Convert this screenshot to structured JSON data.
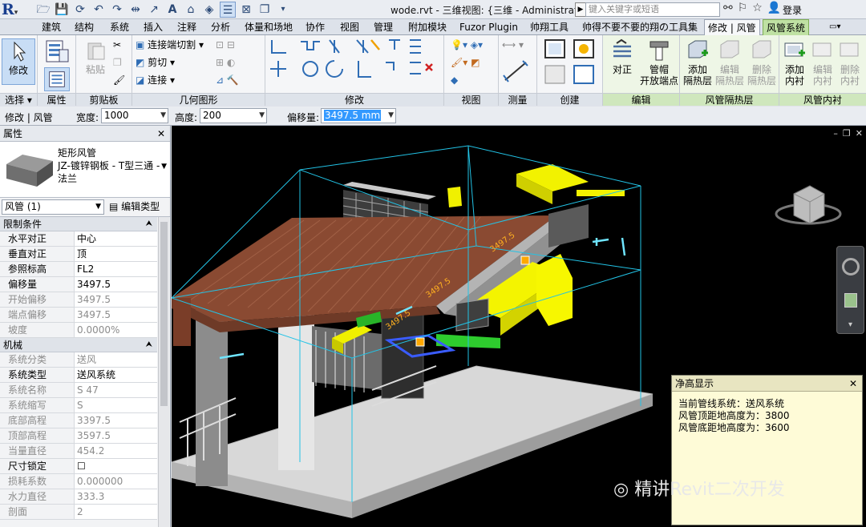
{
  "titlebar": {
    "logo": "R",
    "doc_title": "wode.rvt - 三维视图: {三维 - Administrat...",
    "search_placeholder": "键入关键字或短语",
    "login": "登录"
  },
  "tabs": [
    "建筑",
    "结构",
    "系统",
    "插入",
    "注释",
    "分析",
    "体量和场地",
    "协作",
    "视图",
    "管理",
    "附加模块",
    "Fuzor Plugin",
    "帅翔工具",
    "帅得不要不要的翔の工具集",
    "修改 | 风管",
    "风管系统"
  ],
  "ribbon": {
    "panels": {
      "select": "选择",
      "properties": "属性",
      "clipboard": "剪贴板",
      "geometry": "几何图形",
      "modify": "修改",
      "view": "视图",
      "measure": "测量",
      "create": "创建",
      "edit": "编辑",
      "insulation": "风管隔热层",
      "lining": "风管内衬"
    },
    "modify_btn": "修改",
    "paste_btn": "粘贴",
    "cope": "连接端切割",
    "cut": "剪切",
    "join": "连接",
    "justify": "对正",
    "cap_line1": "管帽",
    "cap_line2": "开放端点",
    "add_insul": [
      "添加",
      "隔热层"
    ],
    "edit_insul": [
      "编辑",
      "隔热层"
    ],
    "del_insul": [
      "删除",
      "隔热层"
    ],
    "add_lining": [
      "添加",
      "内衬"
    ],
    "edit_lining": [
      "编辑",
      "内衬"
    ],
    "del_lining": [
      "删除",
      "内衬"
    ]
  },
  "optionsbar": {
    "context": "修改 | 风管",
    "width_label": "宽度:",
    "width_value": "1000",
    "height_label": "高度:",
    "height_value": "200",
    "offset_label": "偏移量:",
    "offset_value": "3497.5 mm"
  },
  "properties": {
    "header": "属性",
    "type_name": [
      "矩形风管",
      "JZ-镀锌钢板 - T型三通 -",
      "法兰"
    ],
    "instance": "风管 (1)",
    "edit_type": "编辑类型",
    "sections": [
      {
        "title": "限制条件",
        "rows": [
          {
            "k": "水平对正",
            "v": "中心",
            "dim": false
          },
          {
            "k": "垂直对正",
            "v": "顶",
            "dim": false
          },
          {
            "k": "参照标高",
            "v": "FL2",
            "dim": false
          },
          {
            "k": "偏移量",
            "v": "3497.5",
            "dim": false
          },
          {
            "k": "开始偏移",
            "v": "3497.5",
            "dim": true
          },
          {
            "k": "端点偏移",
            "v": "3497.5",
            "dim": true
          },
          {
            "k": "坡度",
            "v": "0.0000%",
            "dim": true
          }
        ]
      },
      {
        "title": "机械",
        "rows": [
          {
            "k": "系统分类",
            "v": "送风",
            "dim": true
          },
          {
            "k": "系统类型",
            "v": "送风系统",
            "dim": false
          },
          {
            "k": "系统名称",
            "v": "S 47",
            "dim": true
          },
          {
            "k": "系统缩写",
            "v": "S",
            "dim": true
          },
          {
            "k": "底部高程",
            "v": "3397.5",
            "dim": true
          },
          {
            "k": "顶部高程",
            "v": "3597.5",
            "dim": true
          },
          {
            "k": "当量直径",
            "v": "454.2",
            "dim": true
          },
          {
            "k": "尺寸锁定",
            "v": "☐",
            "dim": false
          },
          {
            "k": "损耗系数",
            "v": "0.000000",
            "dim": true
          },
          {
            "k": "水力直径",
            "v": "333.3",
            "dim": true
          },
          {
            "k": "剖面",
            "v": "2",
            "dim": true
          }
        ]
      }
    ]
  },
  "viewport": {
    "labels": [
      "3497.5",
      "3497.5",
      "3497.5"
    ]
  },
  "clearance": {
    "title": "净高显示",
    "lines": [
      "当前管线系统：送风系统",
      "风管顶距地高度为：3800",
      "风管底距地高度为：3600"
    ]
  },
  "watermark": "精讲Revit二次开发"
}
